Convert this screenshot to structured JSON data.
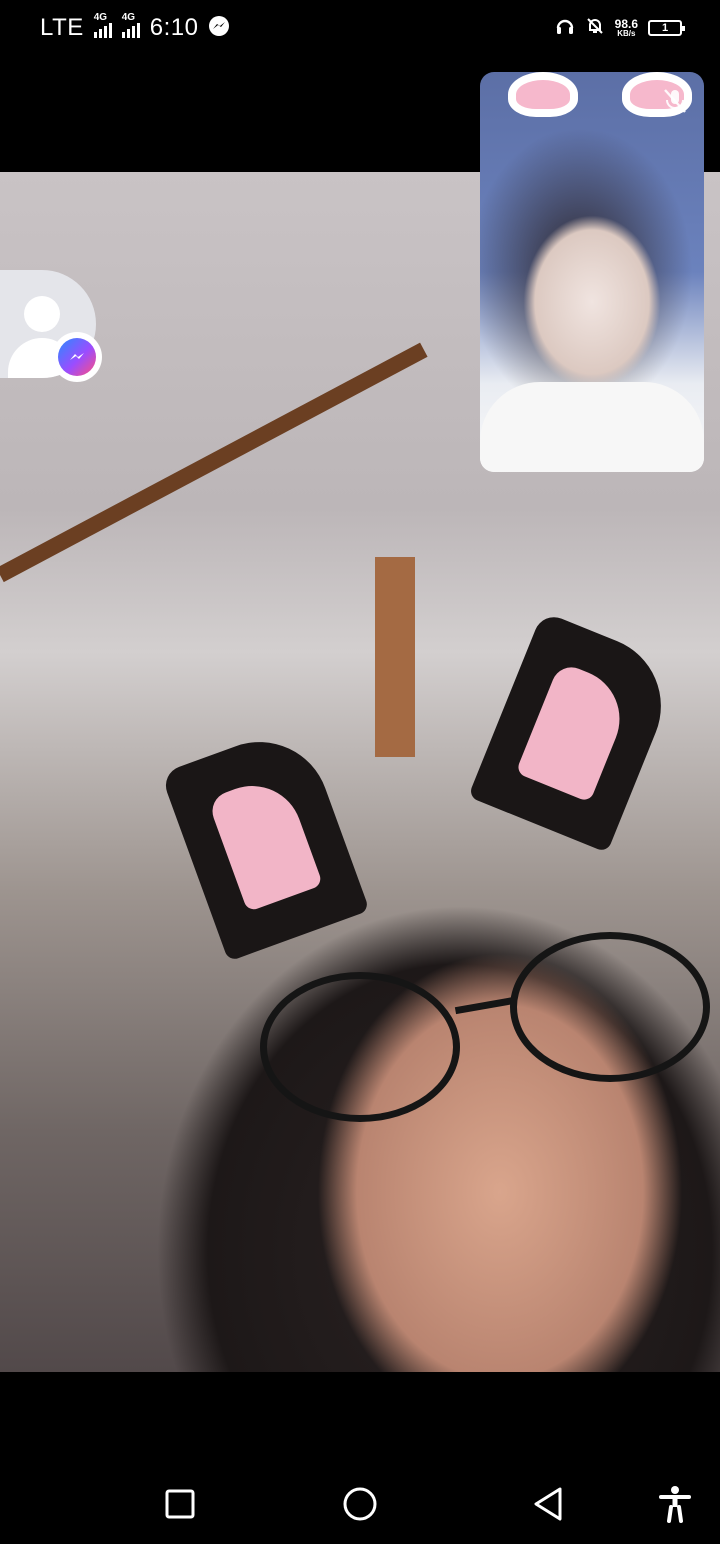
{
  "status_bar": {
    "network_label": "LTE",
    "sim1_tag": "4G",
    "sim2_tag": "4G",
    "time": "6:10",
    "speed_value": "98.6",
    "speed_unit": "KB/s",
    "battery_level": "1",
    "icons": [
      "messenger-notification-icon",
      "headphones-icon",
      "notifications-off-icon"
    ]
  },
  "call": {
    "main_video": "remote-participant-video",
    "self_view": "self-view-video",
    "self_view_mic_muted": true,
    "participant_avatar": "default-avatar-icon",
    "participant_badge": "messenger-icon"
  },
  "nav_bar": {
    "buttons": [
      "recents-button",
      "home-button",
      "back-button",
      "accessibility-button"
    ]
  },
  "colors": {
    "background": "#000000",
    "messenger_gradient_start": "#2a8bff",
    "messenger_gradient_end": "#ff4f7d"
  }
}
